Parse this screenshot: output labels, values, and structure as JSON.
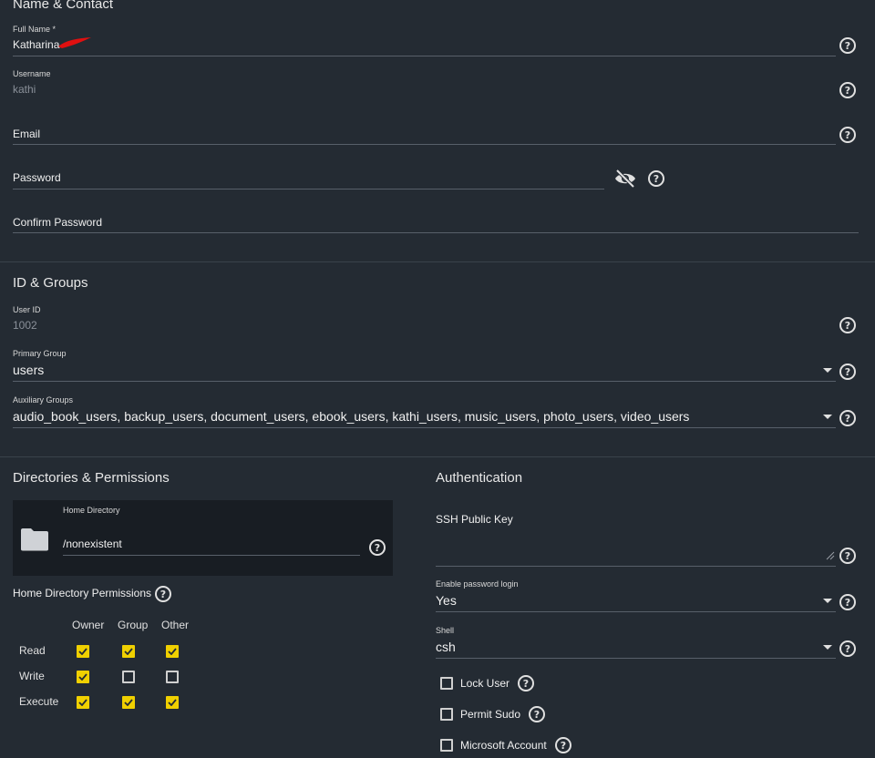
{
  "name_contact": {
    "title": "Name & Contact",
    "full_name": {
      "label": "Full Name *",
      "value": "Katharina"
    },
    "username": {
      "label": "Username",
      "value": "kathi"
    },
    "email": {
      "label": "Email",
      "value": ""
    },
    "password": {
      "label": "Password",
      "value": ""
    },
    "confirm_password": {
      "label": "Confirm Password",
      "value": ""
    }
  },
  "id_groups": {
    "title": "ID & Groups",
    "user_id": {
      "label": "User ID",
      "value": "1002"
    },
    "primary_group": {
      "label": "Primary Group",
      "value": "users"
    },
    "auxiliary_groups": {
      "label": "Auxiliary Groups",
      "value": "audio_book_users, backup_users, document_users, ebook_users, kathi_users, music_users, photo_users, video_users"
    }
  },
  "directories": {
    "title": "Directories & Permissions",
    "home_directory": {
      "label": "Home Directory",
      "value": "/nonexistent"
    },
    "permissions_label": "Home Directory Permissions",
    "columns": [
      "Owner",
      "Group",
      "Other"
    ],
    "rows": [
      {
        "label": "Read",
        "values": [
          true,
          true,
          true
        ]
      },
      {
        "label": "Write",
        "values": [
          true,
          false,
          false
        ]
      },
      {
        "label": "Execute",
        "values": [
          true,
          true,
          true
        ]
      }
    ]
  },
  "authentication": {
    "title": "Authentication",
    "ssh_key": {
      "label": "SSH Public Key",
      "value": ""
    },
    "password_login": {
      "label": "Enable password login",
      "value": "Yes"
    },
    "shell": {
      "label": "Shell",
      "value": "csh"
    },
    "lock_user": {
      "label": "Lock User",
      "checked": false
    },
    "permit_sudo": {
      "label": "Permit Sudo",
      "checked": false
    },
    "microsoft_account": {
      "label": "Microsoft Account",
      "checked": false
    }
  },
  "colors": {
    "background": "#242b33",
    "accent_checkbox": "#f0d000",
    "redaction": "#e01010"
  },
  "icons": [
    "help-icon",
    "eye-off-icon",
    "folder-icon",
    "caret-down-icon",
    "checkmark-icon",
    "resize-grip-icon"
  ]
}
